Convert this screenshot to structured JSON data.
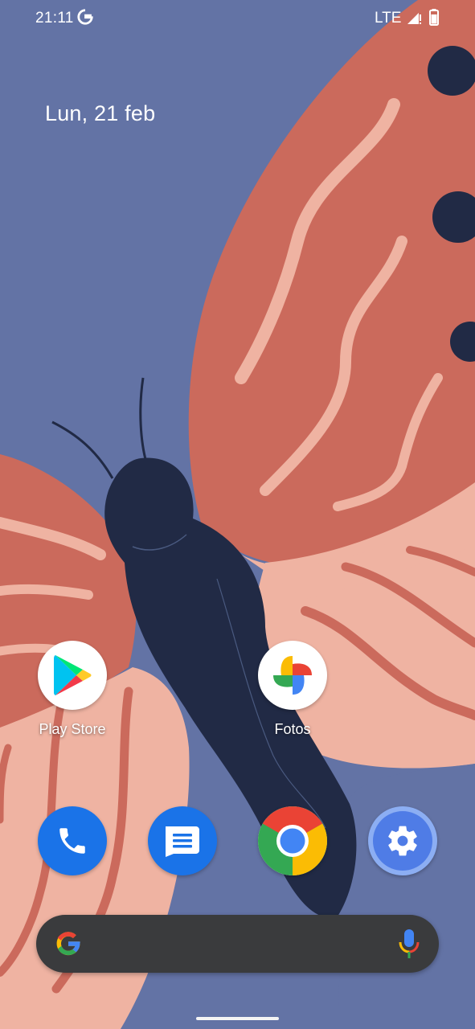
{
  "status_bar": {
    "time": "21:11",
    "network": "LTE",
    "icons": [
      "google-g-icon",
      "signal-icon",
      "battery-icon"
    ]
  },
  "date_widget": {
    "text": "Lun, 21 feb"
  },
  "apps": [
    {
      "label": "Play Store",
      "icon": "play-store-icon"
    },
    {
      "label": "Fotos",
      "icon": "photos-icon"
    }
  ],
  "dock": [
    {
      "app": "phone",
      "icon": "phone-icon",
      "color": "#1A73E8"
    },
    {
      "app": "messages",
      "icon": "messages-icon",
      "color": "#1A73E8"
    },
    {
      "app": "chrome",
      "icon": "chrome-icon",
      "color": "#ffffff"
    },
    {
      "app": "settings",
      "icon": "settings-gear-icon",
      "color": "#4F7CE6"
    }
  ],
  "search_bar": {
    "icons": [
      "google-g-icon",
      "microphone-icon"
    ]
  },
  "colors": {
    "wallpaper_background": "#6373A5",
    "wing_red": "#CB6A5C",
    "wing_pink": "#EFB3A2",
    "butterfly_body": "#212A45",
    "search_bar": "#3A3B3D"
  }
}
